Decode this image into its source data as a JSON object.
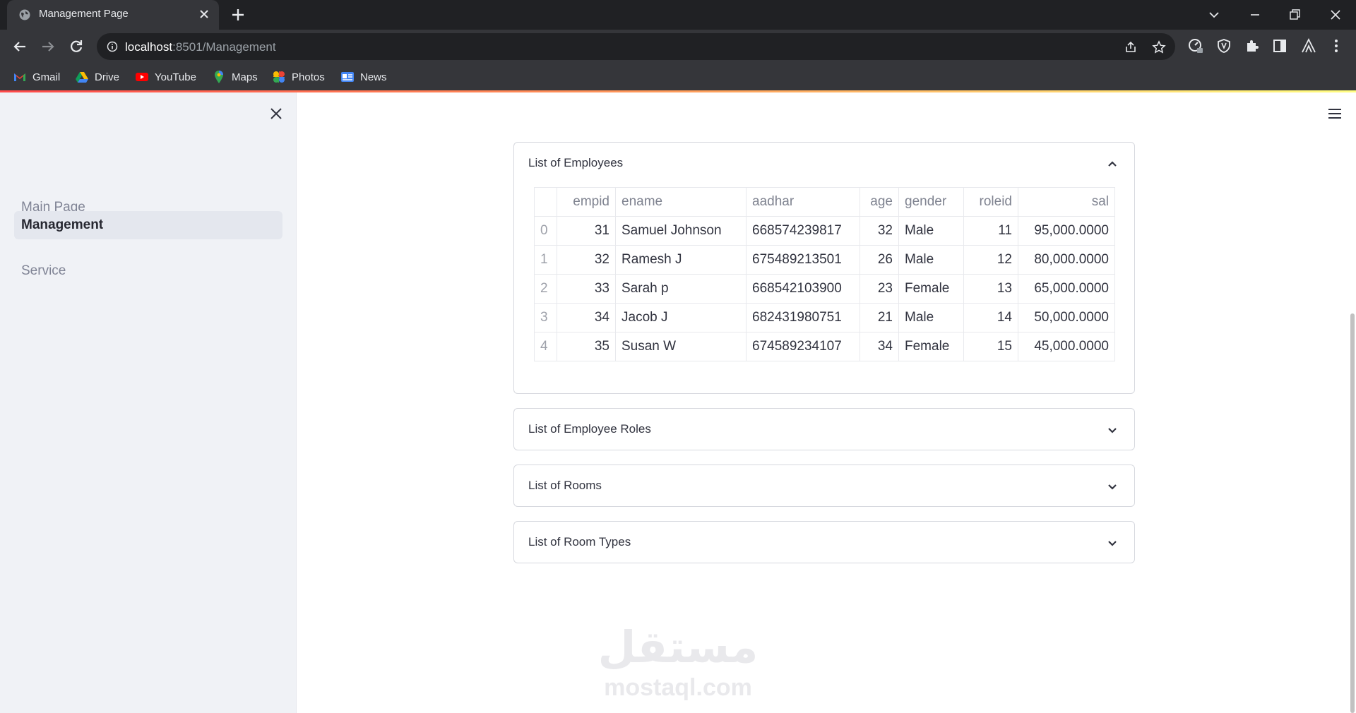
{
  "browser": {
    "tab_title": "Management Page",
    "url_host": "localhost",
    "url_rest": ":8501/Management",
    "bookmarks": [
      {
        "label": "Gmail",
        "icon": "gmail-icon"
      },
      {
        "label": "Drive",
        "icon": "drive-icon"
      },
      {
        "label": "YouTube",
        "icon": "youtube-icon"
      },
      {
        "label": "Maps",
        "icon": "maps-icon"
      },
      {
        "label": "Photos",
        "icon": "photos-icon"
      },
      {
        "label": "News",
        "icon": "news-icon"
      }
    ]
  },
  "sidebar": {
    "items": [
      {
        "label": "Main Page",
        "active": false
      },
      {
        "label": "Management",
        "active": true
      },
      {
        "label": "Service",
        "active": false
      }
    ]
  },
  "main": {
    "expanders": [
      {
        "title": "List of Employees",
        "expanded": true
      },
      {
        "title": "List of Employee Roles",
        "expanded": false
      },
      {
        "title": "List of Rooms",
        "expanded": false
      },
      {
        "title": "List of Room Types",
        "expanded": false
      }
    ],
    "employees_table": {
      "columns": [
        "",
        "empid",
        "ename",
        "aadhar",
        "age",
        "gender",
        "roleid",
        "sal"
      ],
      "rows": [
        [
          "0",
          "31",
          "Samuel Johnson",
          "668574239817",
          "32",
          "Male",
          "11",
          "95,000.0000"
        ],
        [
          "1",
          "32",
          "Ramesh J",
          "675489213501",
          "26",
          "Male",
          "12",
          "80,000.0000"
        ],
        [
          "2",
          "33",
          "Sarah p",
          "668542103900",
          "23",
          "Female",
          "13",
          "65,000.0000"
        ],
        [
          "3",
          "34",
          "Jacob J",
          "682431980751",
          "21",
          "Male",
          "14",
          "50,000.0000"
        ],
        [
          "4",
          "35",
          "Susan W",
          "674589234107",
          "34",
          "Female",
          "15",
          "45,000.0000"
        ]
      ]
    }
  },
  "watermark": {
    "arabic": "مستقل",
    "latin": "mostaql.com"
  },
  "colors": {
    "accent_gradient": [
      "#ff4b4b",
      "#ff9d5c",
      "#fffd80"
    ],
    "sidebar_bg": "#f0f2f6",
    "text": "#31333f"
  }
}
